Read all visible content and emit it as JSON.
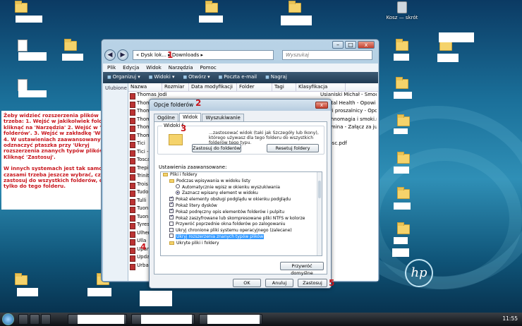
{
  "desktop": {
    "recycle_label": "Kosz — skrót",
    "logo": "hp"
  },
  "instructions": {
    "p1": "Żeby widzieć rozszerzenia plików trzeba: 1. Wejść w jakikolwiek folder i kliknąć na 'Narzędzia' 2. Wejść w 'Opcje folderów'. 3. Wejść w zakładkę 'Widok'. 4. W ustawieniach zaawansowanych odznaczyć ptaszka przy 'Ukryj rozszerzenia znanych typów plików'. 5. Kliknąć 'Zastosuj'.",
    "p2": "W innych systemach jest tak samo, czasami trzeba jeszcze wybrać, czy zastosuj do wszystkich folderów, czy tylko do tego folderu."
  },
  "explorer": {
    "address": "«  Dysk lok...  ▸  Downloads  ▸",
    "search_placeholder": "Wyszukaj",
    "menu": [
      "Plik",
      "Edycja",
      "Widok",
      "Narzędzia",
      "Pomoc"
    ],
    "toolbar": [
      "Organizuj ▾",
      "Widoki ▾",
      "Otwórz ▾",
      "Poczta e-mail",
      "Nagraj"
    ],
    "nav_pane_label": "Ulubione",
    "columns": [
      "Nazwa",
      "Rozmiar",
      "Data modyfikacji",
      "Folder",
      "Tagi",
      "Klasyfikacja"
    ],
    "rows": [
      {
        "name": "Thomas Jodi - O zachodzie słońca.rar",
        "right": "Usianiski Michał - Smocze mleko.rar"
      },
      {
        "name": "Thom",
        "right": "...ental Health - Opowi"
      },
      {
        "name": "Thom",
        "right": "...owi proszalnicy - Opc"
      },
      {
        "name": "Thom",
        "right": "...echnomagia i smoki.r"
      },
      {
        "name": "Thom",
        "right": "...Pamina - Załącz za jutro.r"
      },
      {
        "name": "Thom",
        "right": ".pdf"
      },
      {
        "name": "Tici",
        "right": "...wosc.pdf"
      },
      {
        "name": "Tici -",
        "right": ""
      },
      {
        "name": "Tosca",
        "right": ""
      },
      {
        "name": "Trepi",
        "right": ""
      },
      {
        "name": "Trinit",
        "right": ""
      },
      {
        "name": "Trois",
        "right": ""
      },
      {
        "name": "Tudo",
        "right": ""
      },
      {
        "name": "Tulli",
        "right": ""
      },
      {
        "name": "Tuon",
        "right": ""
      },
      {
        "name": "Tuon",
        "right": ""
      },
      {
        "name": "Tyres",
        "right": ""
      },
      {
        "name": "Ulher",
        "right": ""
      },
      {
        "name": "Ulla",
        "right": ""
      },
      {
        "name": "Upan",
        "right": ""
      },
      {
        "name": "Upda",
        "right": ""
      },
      {
        "name": "Urbai",
        "right": ""
      }
    ]
  },
  "dialog": {
    "title": "Opcje folderów",
    "close": "x",
    "tabs": [
      "Ogólne",
      "Widok",
      "Wyszukiwanie"
    ],
    "group_title": "Widoki f",
    "group_text": "...zastosować widok (taki jak Szczegóły lub Ikony), którego używasz dla tego folderu do wszystkich folderów tego typu.",
    "btn_apply_folders": "Zastosuj do folderów",
    "btn_reset_folders": "Resetuj foldery",
    "advanced_label": "Ustawienia zaawansowane:",
    "items": [
      {
        "kind": "folder",
        "label": "Pliki i foldery",
        "indent": 0
      },
      {
        "kind": "folder",
        "label": "Podczas wpisywania w widoku listy",
        "indent": 1
      },
      {
        "kind": "radio-off",
        "label": "Automatycznie wpisz w okienku wyszukiwania",
        "indent": 2
      },
      {
        "kind": "radio-on",
        "label": "Zaznacz wpisany element w widoku",
        "indent": 2
      },
      {
        "kind": "check-on",
        "label": "Pokaż elementy obsługi podglądu w okienku podglądu",
        "indent": 1
      },
      {
        "kind": "check-on",
        "label": "Pokaż litery dysków",
        "indent": 1
      },
      {
        "kind": "check-on",
        "label": "Pokaż podręczny opis elementów folderów i pulpitu",
        "indent": 1
      },
      {
        "kind": "check-on",
        "label": "Pokaż zaszyfrowane lub skompresowane pliki NTFS w kolorze",
        "indent": 1
      },
      {
        "kind": "check-off",
        "label": "Przywróć poprzednie okna folderów po zalogowaniu",
        "indent": 1
      },
      {
        "kind": "check-off",
        "label": "Ukryj chronione pliki systemu operacyjnego (zalecane)",
        "indent": 1
      },
      {
        "kind": "check-off-sel",
        "label": "Ukryj rozszerzenia znanych typów plików",
        "indent": 1
      },
      {
        "kind": "folder",
        "label": "Ukryte pliki i foldery",
        "indent": 1
      }
    ],
    "btn_defaults": "Przywróć domyślne",
    "btn_ok": "OK",
    "btn_cancel": "Anuluj",
    "btn_apply": "Zastosuj"
  },
  "markers": [
    "1",
    "2",
    "3",
    "4",
    "5"
  ],
  "taskbar": {
    "clock": "11:55"
  },
  "colors": {
    "annotation_red": "#c8161d",
    "selection_blue": "#3399ff"
  }
}
